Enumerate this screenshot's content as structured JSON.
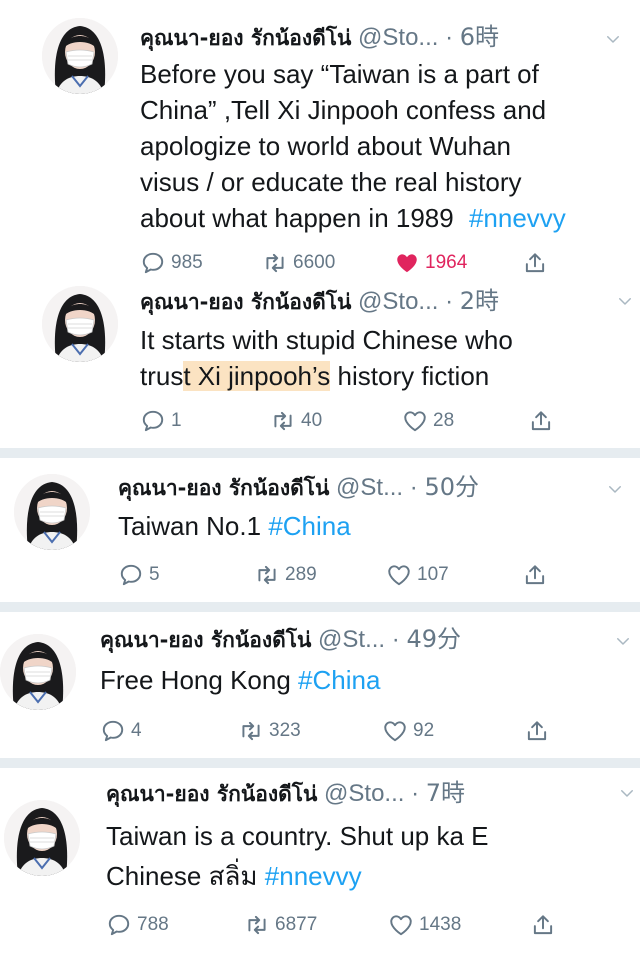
{
  "colors": {
    "accent": "#1da1f2",
    "like": "#e0245e",
    "muted": "#657786",
    "highlight": "#fbe3c2"
  },
  "tweets": [
    {
      "name": "คุณนา-ยอง รักน้องดีโน่",
      "handle": "@Sto...",
      "dot": "·",
      "time": "6時",
      "lines": [
        "Before you say “Taiwan is a part of",
        "China” ,Tell Xi Jinpooh confess and",
        "apologize to world about Wuhan",
        "visus / or educate the real history",
        "about what happen in 1989"
      ],
      "hashtag": "#nnevvy",
      "replies": "985",
      "retweets": "6600",
      "likes": "1964"
    },
    {
      "name": "คุณนา-ยอง รักน้องดีโน่",
      "handle": "@Sto...",
      "dot": "·",
      "time": "2時",
      "line1": "It starts with stupid  Chinese who",
      "line2_pre": "trus",
      "line2_hl": "t Xi jinpooh’s",
      "line2_post": " history fiction",
      "replies": "1",
      "retweets": "40",
      "likes": "28"
    },
    {
      "name": "คุณนา-ยอง รักน้องดีโน่",
      "handle": "@St...",
      "dot": "·",
      "time": "50分",
      "text": "Taiwan No.1 ",
      "hashtag": "#China",
      "replies": "5",
      "retweets": "289",
      "likes": "107"
    },
    {
      "name": "คุณนา-ยอง รักน้องดีโน่",
      "handle": "@St...",
      "dot": "·",
      "time": "49分",
      "text": "Free Hong Kong ",
      "hashtag": "#China",
      "replies": "4",
      "retweets": "323",
      "likes": "92"
    },
    {
      "name": "คุณนา-ยอง รักน้องดีโน่",
      "handle": "@Sto...",
      "dot": "·",
      "time": "7時",
      "line1": "Taiwan is a country. Shut up ka E",
      "line2": "Chinese สลิ่ม ",
      "hashtag": "#nnevvy",
      "replies": "788",
      "retweets": "6877",
      "likes": "1438"
    }
  ]
}
